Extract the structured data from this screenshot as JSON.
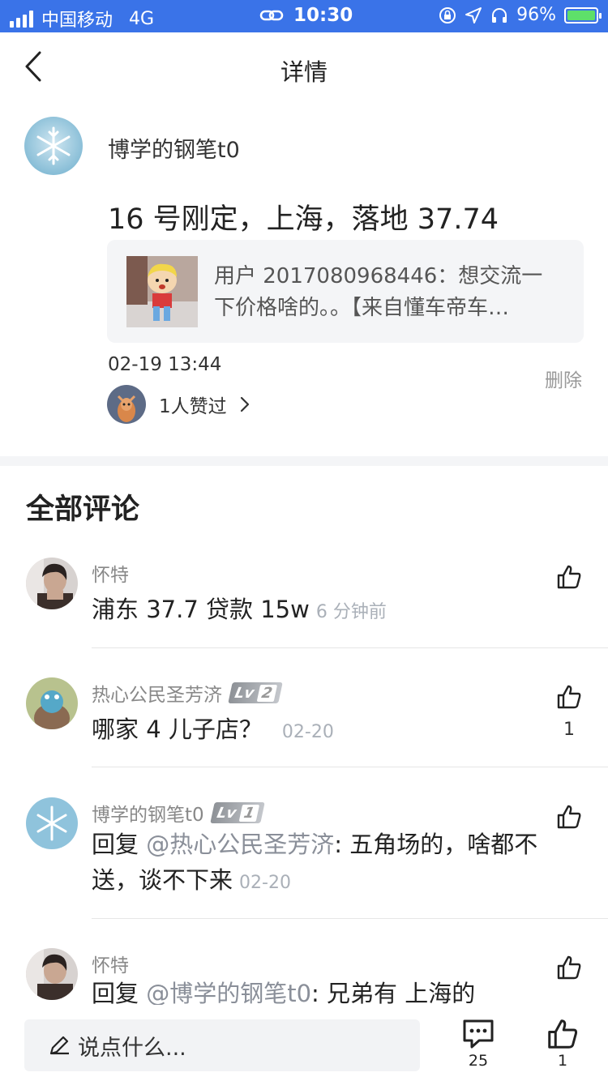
{
  "status_bar": {
    "carrier": "中国移动",
    "network": "4G",
    "time": "10:30",
    "battery_percent": "96%",
    "battery_level": 0.96,
    "background_color": "#3a73e8"
  },
  "nav": {
    "title": "详情",
    "back_icon": "chevron-left-icon"
  },
  "post": {
    "author": "博学的钢笔t0",
    "text": "16 号刚定，上海，落地 37.74",
    "quote_text": "用户 2017080968446：想交流一下价格啥的。。【来自懂车帝车…",
    "time": "02-19 13:44",
    "delete_label": "删除",
    "likers_text": "1人赞过"
  },
  "comments_section": {
    "title": "全部评论",
    "items": [
      {
        "name": "怀特",
        "level": "",
        "reply_prefix": "",
        "mention": "",
        "text": "浦东 37.7 贷款 15w",
        "time": "6 分钟前",
        "likes": ""
      },
      {
        "name": "热心公民圣芳济",
        "level": "2",
        "reply_prefix": "",
        "mention": "",
        "text": "哪家 4 儿子店？",
        "time": "02-20",
        "likes": "1"
      },
      {
        "name": "博学的钢笔t0",
        "level": "1",
        "reply_prefix": "回复 ",
        "mention": "@热心公民圣芳济",
        "text": ": 五角场的，啥都不送，谈不下来",
        "time": "02-20",
        "likes": ""
      },
      {
        "name": "怀特",
        "level": "",
        "reply_prefix": "回复 ",
        "mention": "@博学的钢笔t0",
        "text": ": 兄弟有 上海的",
        "time": "",
        "likes": ""
      }
    ]
  },
  "bottom_bar": {
    "input_placeholder": "说点什么...",
    "comment_count": "25",
    "like_count": "1"
  },
  "level_badge_label": "Lv"
}
